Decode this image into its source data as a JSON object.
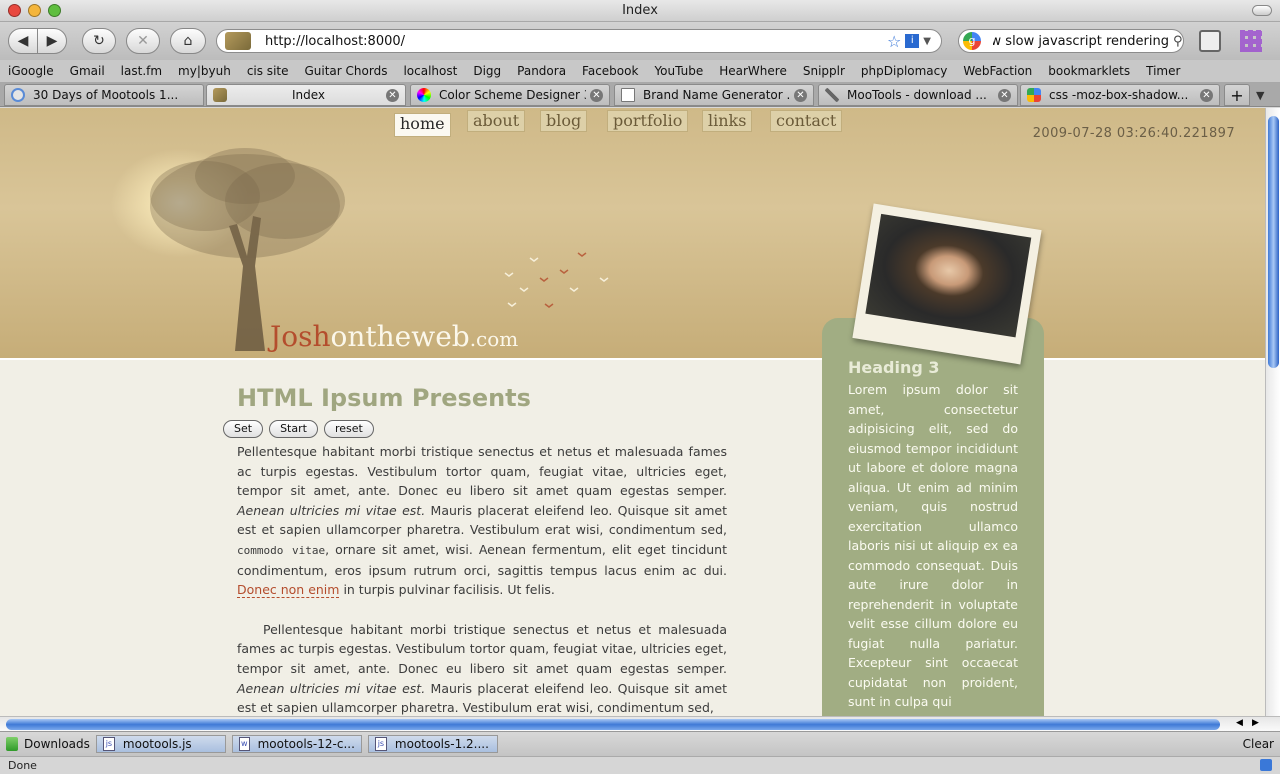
{
  "window": {
    "title": "Index"
  },
  "toolbar": {
    "url": "http://localhost:8000/",
    "search_text": "ow slow javascript rendering"
  },
  "bookmarks": [
    "iGoogle",
    "Gmail",
    "last.fm",
    "my|byuh",
    "cis site",
    "Guitar Chords",
    "localhost",
    "Digg",
    "Pandora",
    "Facebook",
    "YouTube",
    "HearWhere",
    "Snipplr",
    "phpDiplomacy",
    "WebFaction",
    "bookmarklets",
    "Timer"
  ],
  "tabs": [
    {
      "label": "30 Days of Mootools 1..."
    },
    {
      "label": "Index"
    },
    {
      "label": "Color Scheme Designer 3"
    },
    {
      "label": "Brand Name Generator ..."
    },
    {
      "label": "MooTools - download ..."
    },
    {
      "label": "css -moz-box-shadow..."
    }
  ],
  "page": {
    "nav": [
      "home",
      "about",
      "blog",
      "portfolio",
      "links",
      "contact"
    ],
    "timestamp": "2009-07-28 03:26:40.221897",
    "logo": {
      "josh": "Josh",
      "ontheweb": "ontheweb",
      "com": ".com"
    },
    "heading": "HTML Ipsum Presents",
    "buttons": {
      "set": "Set",
      "start": "Start",
      "reset": "reset"
    },
    "p1": {
      "a": "Pellentesque habitant morbi tristique senectus et netus et malesuada fames ac turpis egestas. Vestibulum tortor quam, feugiat vitae, ultricies eget, tempor sit amet, ante. Donec eu libero sit amet quam egestas semper. ",
      "em": "Aenean ultricies mi vitae est.",
      "b": " Mauris placerat eleifend leo. Quisque sit amet est et sapien ullamcorper pharetra. Vestibulum erat wisi, condimentum sed, ",
      "code": "commodo vitae",
      "c": ", ornare sit amet, wisi. Aenean fermentum, elit eget tincidunt condimentum, eros ipsum rutrum orci, sagittis tempus lacus enim ac dui. ",
      "link": "Donec non enim",
      "d": " in turpis pulvinar facilisis. Ut felis."
    },
    "p2": {
      "a": "Pellentesque habitant morbi tristique senectus et netus et malesuada fames ac turpis egestas. Vestibulum tortor quam, feugiat vitae, ultricies eget, tempor sit amet, ante. Donec eu libero sit amet quam egestas semper. ",
      "em": "Aenean ultricies mi vitae est.",
      "b": " Mauris placerat eleifend leo. Quisque sit amet est et sapien ullamcorper pharetra. Vestibulum erat wisi, condimentum sed,"
    },
    "sidebar": {
      "heading": "Heading 3",
      "text": "Lorem ipsum dolor sit amet, consectetur adipisicing elit, sed do eiusmod tempor incididunt ut labore et dolore magna aliqua. Ut enim ad minim veniam, quis nostrud exercitation ullamco laboris nisi ut aliquip ex ea commodo consequat. Duis aute irure dolor in reprehenderit in voluptate velit esse cillum dolore eu fugiat nulla pariatur. Excepteur sint occaecat cupidatat non proident, sunt in culpa qui"
    }
  },
  "downloads": {
    "label": "Downloads",
    "items": [
      "mootools.js",
      "mootools-12-c...",
      "mootools-1.2...."
    ],
    "clear": "Clear"
  },
  "status": "Done",
  "colors": {
    "accent_link": "#b44d2d",
    "heading": "#a0a680",
    "sidebar": "#a1ad83"
  }
}
